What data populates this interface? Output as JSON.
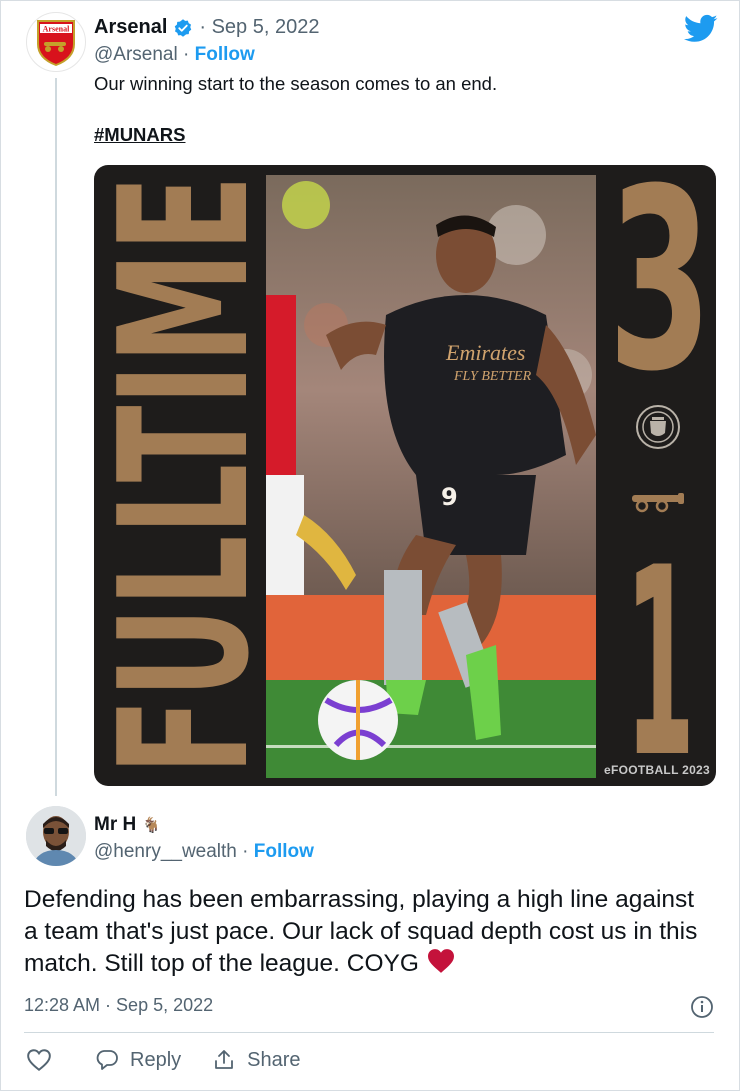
{
  "tweet": {
    "author_name": "Arsenal",
    "verified": true,
    "date": "· Sep 5, 2022",
    "handle": "@Arsenal",
    "separator": " · ",
    "follow_label": "Follow",
    "text": "Our winning start to the season comes to an end.",
    "hashtag": "#MUNARS",
    "avatar_icon": "arsenal-crest-icon",
    "brand_icon": "twitter-bird-icon",
    "media": {
      "headline": "FULLTIME",
      "home_score": "3",
      "away_score": "1",
      "home_crest": "manchester-united-crest-icon",
      "away_crest": "arsenal-cannon-icon",
      "watermark": "eFOOTBALL 2023",
      "accent_color": "#a27c54",
      "background_color": "#1e1c1b"
    }
  },
  "reply": {
    "author_name": "Mr H",
    "name_emoji": "🐐",
    "handle": "@henry__wealth",
    "separator": " · ",
    "follow_label": "Follow",
    "text": "Defending has been embarrassing, playing a high line against a team that's just pace. Our lack of squad depth cost us in this match. Still top of the league. COYG",
    "timestamp": "12:28 AM · Sep 5, 2022",
    "actions": {
      "like_icon": "heart-outline-icon",
      "reply_label": "Reply",
      "share_label": "Share"
    }
  },
  "colors": {
    "link_blue": "#1d9bf0",
    "muted_text": "#536471",
    "heart_red": "#c4123b"
  }
}
